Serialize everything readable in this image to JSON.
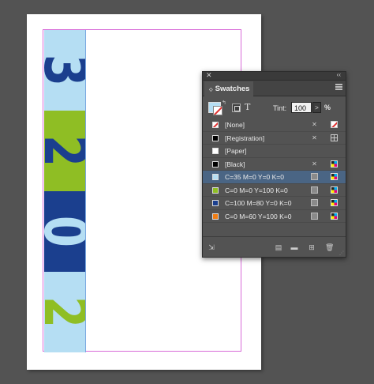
{
  "document": {
    "digits": [
      {
        "char": "3",
        "fill": "#b5def3",
        "color": "#1b3f8e"
      },
      {
        "char": "2",
        "fill": "#8fbe24",
        "color": "#1b3f8e"
      },
      {
        "char": "0",
        "fill": "#1b3f8e",
        "color": "#b5def3"
      },
      {
        "char": "2",
        "fill": "#b5def3",
        "color": "#8fbe24"
      }
    ]
  },
  "panel": {
    "close_glyph": "✕",
    "collapse_glyph": "‹‹",
    "tab_arrow": "◇",
    "tab_label": "Swatches",
    "tint_label": "Tint:",
    "tint_value": "100",
    "tint_arrow": ">",
    "tint_unit": "%",
    "swatches": [
      {
        "name": "[None]",
        "chip": "none",
        "icons": [
          "noedit-icon",
          "none-swatch-icon"
        ]
      },
      {
        "name": "[Registration]",
        "chip": "#000000",
        "icons": [
          "noedit-icon",
          "registration-icon"
        ]
      },
      {
        "name": "[Paper]",
        "chip": "#ffffff",
        "icons": []
      },
      {
        "name": "[Black]",
        "chip": "#000000",
        "icons": [
          "noedit-icon",
          "process-cmyk-icon"
        ]
      },
      {
        "name": "C=35 M=0 Y=0 K=0",
        "chip": "#b5def3",
        "icons": [
          "process-icon",
          "process-cmyk-icon"
        ],
        "selected": true
      },
      {
        "name": "C=0 M=0 Y=100 K=0",
        "chip": "#8fbe24",
        "icons": [
          "process-icon",
          "process-cmyk-icon"
        ]
      },
      {
        "name": "C=100 M=80 Y=0 K=0",
        "chip": "#1b3f8e",
        "icons": [
          "process-icon",
          "process-cmyk-icon"
        ]
      },
      {
        "name": "C=0 M=60 Y=100 K=0",
        "chip": "#ef7d14",
        "icons": [
          "process-icon",
          "process-cmyk-icon"
        ]
      }
    ]
  }
}
